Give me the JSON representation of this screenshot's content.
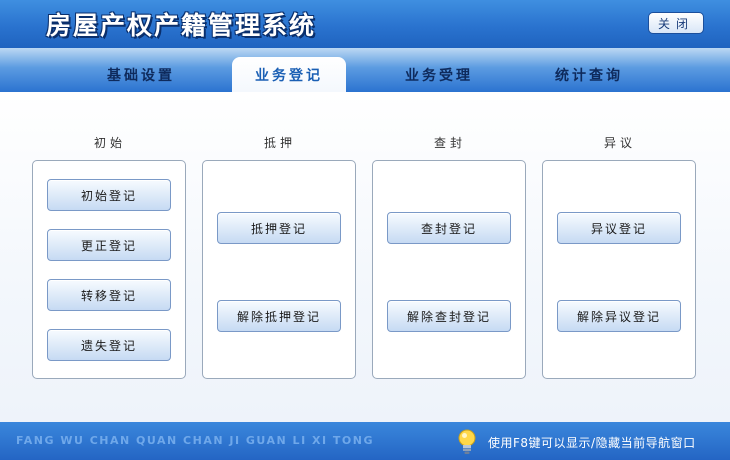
{
  "header": {
    "title": "房屋产权产籍管理系统",
    "close_label": "关闭"
  },
  "nav": {
    "tabs": [
      {
        "label": "基础设置"
      },
      {
        "label": "业务登记",
        "active": true
      },
      {
        "label": "业务受理"
      },
      {
        "label": "统计查询"
      }
    ]
  },
  "groups": [
    {
      "label": "初始",
      "buttons": [
        "初始登记",
        "更正登记",
        "转移登记",
        "遗失登记"
      ]
    },
    {
      "label": "抵押",
      "buttons": [
        "抵押登记",
        "解除抵押登记"
      ]
    },
    {
      "label": "查封",
      "buttons": [
        "查封登记",
        "解除查封登记"
      ]
    },
    {
      "label": "异议",
      "buttons": [
        "异议登记",
        "解除异议登记"
      ]
    }
  ],
  "footer": {
    "pinyin": "FANG WU CHAN QUAN CHAN JI GUAN LI XI TONG",
    "hint": "使用F8键可以显示/隐藏当前导航窗口",
    "hint_icon": "lightbulb-icon"
  },
  "colors": {
    "header_blue": "#2a73cf",
    "accent_text": "#1a5fb4"
  }
}
